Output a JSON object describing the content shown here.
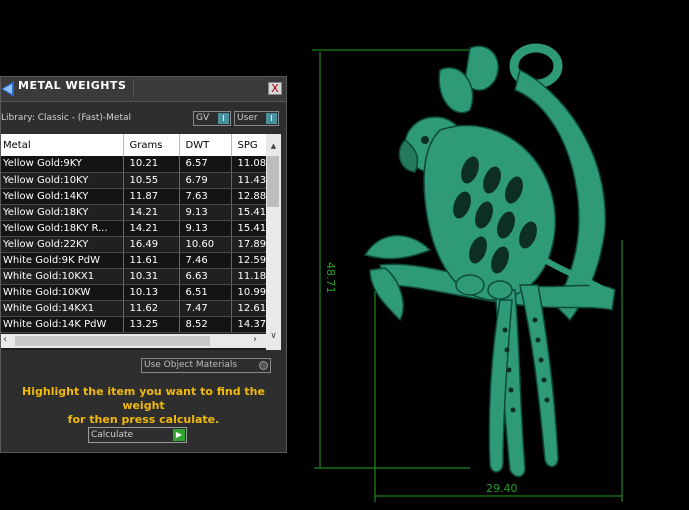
{
  "viewport": {
    "dim_height": "48.71",
    "dim_width": "29.40",
    "model_color": "#2e9a78",
    "dim_color": "#22a022"
  },
  "panel": {
    "title": "METAL WEIGHTS",
    "close_glyph": "X",
    "library": "Library: Classic - (Fast)-Metal",
    "toggles": {
      "gv": "GV",
      "user": "User"
    },
    "table": {
      "headers": [
        "Metal",
        "Grams",
        "DWT",
        "SPG"
      ],
      "rows": [
        [
          "Yellow Gold:9KY",
          "10.21",
          "6.57",
          "11.08"
        ],
        [
          "Yellow Gold:10KY",
          "10.55",
          "6.79",
          "11.43"
        ],
        [
          "Yellow Gold:14KY",
          "11.87",
          "7.63",
          "12.88"
        ],
        [
          "Yellow Gold:18KY",
          "14.21",
          "9.13",
          "15.41"
        ],
        [
          "Yellow Gold:18KY R...",
          "14.21",
          "9.13",
          "15.41"
        ],
        [
          "Yellow Gold:22KY",
          "16.49",
          "10.60",
          "17.89"
        ],
        [
          "White Gold:9K PdW",
          "11.61",
          "7.46",
          "12.59"
        ],
        [
          "White Gold:10KX1",
          "10.31",
          "6.63",
          "11.18"
        ],
        [
          "White Gold:10KW",
          "10.13",
          "6.51",
          "10.99"
        ],
        [
          "White Gold:14KX1",
          "11.62",
          "7.47",
          "12.61"
        ],
        [
          "White Gold:14K PdW",
          "13.25",
          "8.52",
          "14.37"
        ]
      ]
    },
    "use_object_materials": "Use Object Materials",
    "instructions_line1": "Highlight the item you want to find the weight",
    "instructions_line2": "for then press calculate.",
    "calculate": "Calculate",
    "instruction_color": "#f2b90c"
  }
}
